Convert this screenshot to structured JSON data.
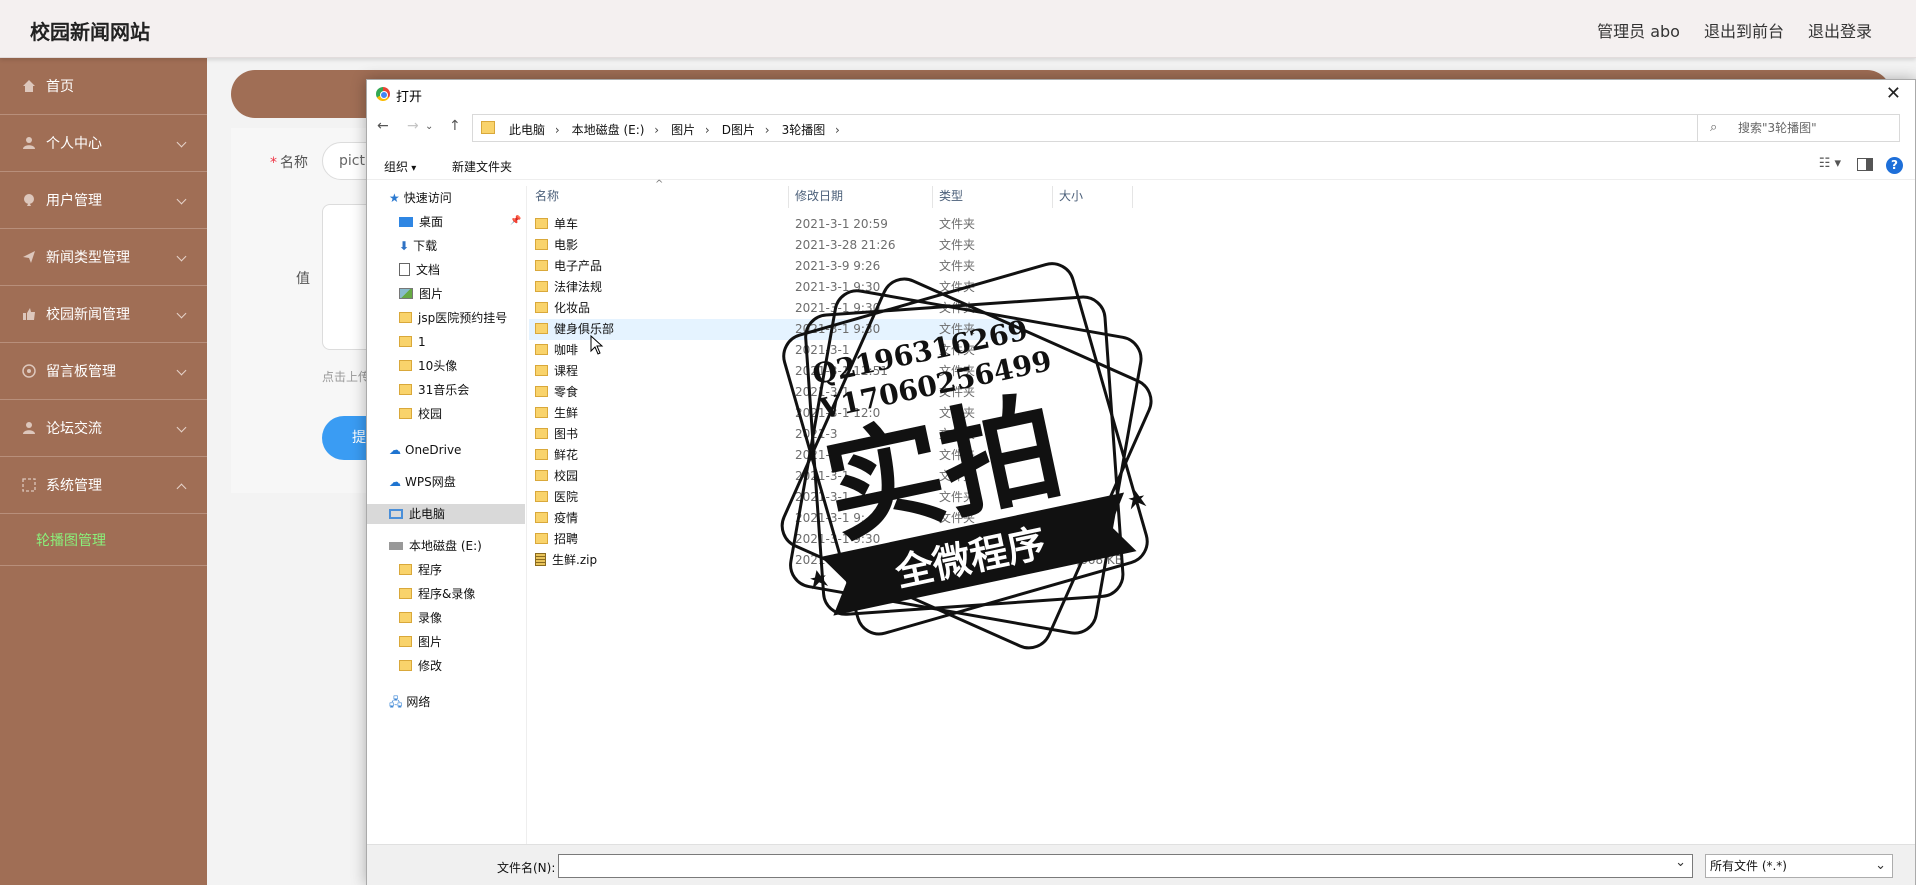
{
  "app": {
    "site_title": "校园新闻网站",
    "top_links": [
      "管理员 abo",
      "退出到前台",
      "退出登录"
    ]
  },
  "sidebar": {
    "items": [
      {
        "label": "首页",
        "icon": "home-icon"
      },
      {
        "label": "个人中心",
        "icon": "user-icon"
      },
      {
        "label": "用户管理",
        "icon": "users-icon"
      },
      {
        "label": "新闻类型管理",
        "icon": "send-icon"
      },
      {
        "label": "校园新闻管理",
        "icon": "thumb-icon"
      },
      {
        "label": "留言板管理",
        "icon": "message-icon"
      },
      {
        "label": "论坛交流",
        "icon": "chat-icon"
      },
      {
        "label": "系统管理",
        "icon": "settings-icon"
      }
    ],
    "active_sub": "轮播图管理"
  },
  "form": {
    "name_label": "名称",
    "name_value": "pictu",
    "value_label": "值",
    "hint": "点击上传",
    "submit_label": "提交"
  },
  "dialog": {
    "title": "打开",
    "close_glyph": "✕",
    "breadcrumbs": [
      "此电脑",
      "本地磁盘 (E:)",
      "图片",
      "D图片",
      "3轮播图"
    ],
    "search_placeholder": "搜索\"3轮播图\"",
    "toolbar": {
      "organize": "组织",
      "new_folder": "新建文件夹",
      "help": "?"
    },
    "tree": {
      "quick_access": "快速访问",
      "quick_items": [
        "桌面",
        "下载",
        "文档",
        "图片",
        "jsp医院预约挂号",
        "1",
        "10头像",
        "31音乐会",
        "校园"
      ],
      "onedrive": "OneDrive",
      "wps": "WPS网盘",
      "this_pc": "此电脑",
      "drive": "本地磁盘 (E:)",
      "drive_items": [
        "程序",
        "程序&录像",
        "录像",
        "图片",
        "修改"
      ],
      "network": "网络"
    },
    "columns": [
      "名称",
      "修改日期",
      "类型",
      "大小"
    ],
    "files": [
      {
        "name": "单车",
        "date": "2021-3-1 20:59",
        "type": "文件夹",
        "size": ""
      },
      {
        "name": "电影",
        "date": "2021-3-28 21:26",
        "type": "文件夹",
        "size": ""
      },
      {
        "name": "电子产品",
        "date": "2021-3-9 9:26",
        "type": "文件夹",
        "size": ""
      },
      {
        "name": "法律法规",
        "date": "2021-3-1 9:30",
        "type": "文件夹",
        "size": ""
      },
      {
        "name": "化妆品",
        "date": "2021-3-1 9:30",
        "type": "文件夹",
        "size": ""
      },
      {
        "name": "健身俱乐部",
        "date": "2021-3-1 9:30",
        "type": "文件夹",
        "size": ""
      },
      {
        "name": "咖啡",
        "date": "2021-3-1",
        "type": "文件夹",
        "size": ""
      },
      {
        "name": "课程",
        "date": "2021-3-1 11:51",
        "type": "文件夹",
        "size": ""
      },
      {
        "name": "零食",
        "date": "2021-3-1",
        "type": "文件夹",
        "size": ""
      },
      {
        "name": "生鲜",
        "date": "2021-3-1 12:0",
        "type": "文件夹",
        "size": ""
      },
      {
        "name": "图书",
        "date": "2021-3",
        "type": "文件夹",
        "size": ""
      },
      {
        "name": "鲜花",
        "date": "2021-3",
        "type": "文件夹",
        "size": ""
      },
      {
        "name": "校园",
        "date": "2021-3-1",
        "type": "文件夹",
        "size": ""
      },
      {
        "name": "医院",
        "date": "2021-3-1",
        "type": "文件夹",
        "size": ""
      },
      {
        "name": "疫情",
        "date": "2021-3-1 9:",
        "type": "文件夹",
        "size": ""
      },
      {
        "name": "招聘",
        "date": "2021-3-1 9:30",
        "type": "文件夹",
        "size": ""
      },
      {
        "name": "生鲜.zip",
        "date": "2021-2-24 16:",
        "type": "",
        "size": "1,668 KB"
      }
    ],
    "filename_label": "文件名(N):",
    "filename_value": "",
    "filetype_value": "所有文件 (*.*)"
  },
  "watermark": {
    "line1": "Q2196316269",
    "line2": "V17060256499",
    "big": "实拍",
    "ribbon": "全微程序"
  }
}
